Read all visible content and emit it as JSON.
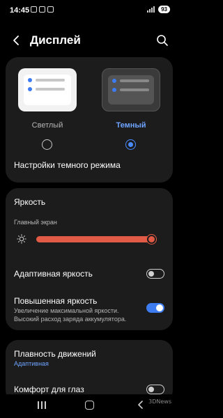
{
  "status": {
    "time": "14:45",
    "battery": "93"
  },
  "header": {
    "title": "Дисплей",
    "back_icon": "back-arrow-icon",
    "search_icon": "search-icon"
  },
  "theme": {
    "light_label": "Светлый",
    "dark_label": "Темный",
    "selected": "dark",
    "dark_mode_settings": "Настройки темного режима"
  },
  "brightness": {
    "title": "Яркость",
    "main_screen_label": "Главный экран",
    "level": 0.95,
    "adaptive_label": "Адаптивная яркость",
    "adaptive_enabled": false,
    "extra_label": "Повышенная яркость",
    "extra_desc": "Увеличение максимальной яркости. Высокий расход заряда аккумулятора.",
    "extra_enabled": true
  },
  "motion": {
    "smoothness_label": "Плавность движений",
    "smoothness_value": "Адаптивная",
    "eye_comfort_label": "Комфорт для глаз",
    "eye_comfort_enabled": false
  },
  "watermark": "3DNews",
  "colors": {
    "accent": "#3d7cf0",
    "slider": "#e05a46",
    "card": "#1c1c1c"
  }
}
